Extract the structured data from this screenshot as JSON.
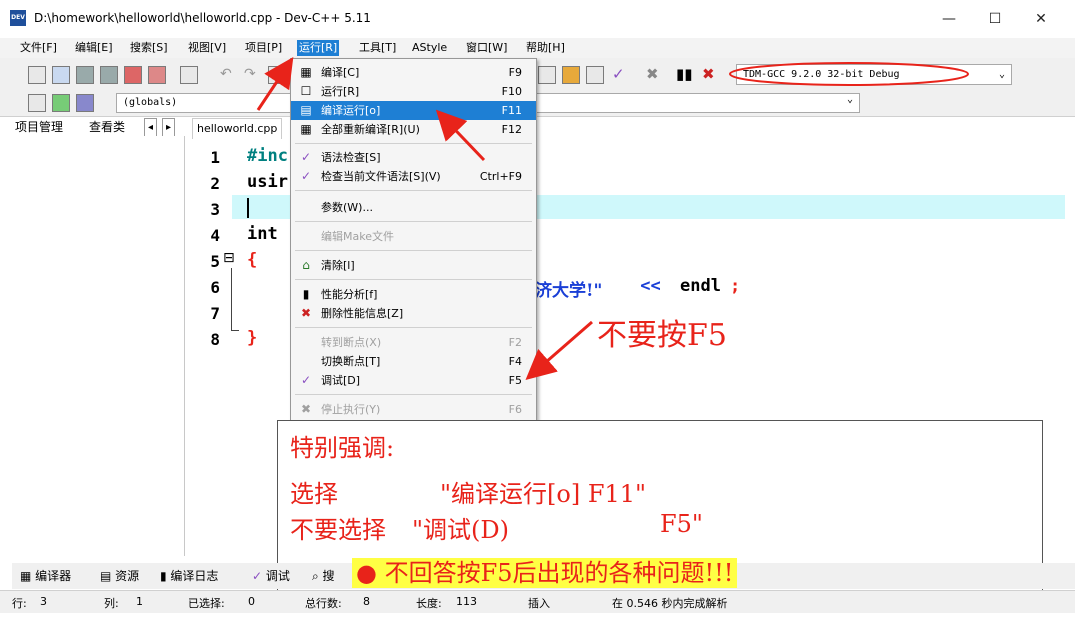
{
  "window": {
    "title": "D:\\homework\\helloworld\\helloworld.cpp - Dev-C++ 5.11",
    "app_icon_text": "DEV C++",
    "minimize": "—",
    "maximize": "☐",
    "close": "✕"
  },
  "menubar": {
    "items": [
      "文件[F]",
      "编辑[E]",
      "搜索[S]",
      "视图[V]",
      "项目[P]",
      "运行[R]",
      "工具[T]",
      "AStyle",
      "窗口[W]",
      "帮助[H]"
    ]
  },
  "toolbar": {
    "compiler_select": "TDM-GCC 9.2.0 32-bit Debug",
    "globals_select": "(globals)"
  },
  "left_tabs": {
    "project": "项目管理",
    "classes": "查看类",
    "prev": "◂",
    "next": "▸"
  },
  "editor": {
    "file_tab": "helloworld.cpp",
    "line_numbers": [
      "1",
      "2",
      "3",
      "4",
      "5",
      "6",
      "7",
      "8"
    ],
    "fold_marker": "⊟",
    "lines": {
      "l1": "#inc",
      "l2": "usir",
      "l4": "int",
      "l5": "{",
      "l6_str": "济大学!\"",
      "l6_op": " << ",
      "l6_rest": "endl",
      "l6_semi": ";",
      "l8": "}"
    }
  },
  "run_menu": {
    "items": [
      {
        "label": "编译[C]",
        "key": "F9",
        "icon": "▦"
      },
      {
        "label": "运行[R]",
        "key": "F10",
        "icon": "☐"
      },
      {
        "label": "编译运行[o]",
        "key": "F11",
        "icon": "▤"
      },
      {
        "label": "全部重新编译[R](U)",
        "key": "F12",
        "icon": "▦"
      },
      {
        "label": "语法检查[S]",
        "key": "",
        "icon": "✓"
      },
      {
        "label": "检查当前文件语法[S](V)",
        "key": "Ctrl+F9",
        "icon": "✓"
      },
      {
        "label": "参数(W)...",
        "key": "",
        "icon": ""
      },
      {
        "label": "编辑Make文件",
        "key": "",
        "icon": ""
      },
      {
        "label": "清除[l]",
        "key": "",
        "icon": "⌂"
      },
      {
        "label": "性能分析[f]",
        "key": "",
        "icon": "▮"
      },
      {
        "label": "删除性能信息[Z]",
        "key": "",
        "icon": "✖"
      },
      {
        "label": "转到断点(X)",
        "key": "F2",
        "icon": ""
      },
      {
        "label": "切换断点[T]",
        "key": "F4",
        "icon": ""
      },
      {
        "label": "调试[D]",
        "key": "F5",
        "icon": "✓"
      },
      {
        "label": "停止执行(Y)",
        "key": "F6",
        "icon": "✖"
      }
    ]
  },
  "annotations": {
    "no_f5": "不要按F5",
    "note_title": "特别强调:",
    "note_choose_a": "选择",
    "note_choose_b": "\"编译运行[o] F11\"",
    "note_dont_a": "不要选择",
    "note_dont_b": "\"调试(D)",
    "note_dont_c": "F5\"",
    "note_final": "● 不回答按F5后出现的各种问题!!!",
    "arrow_color": "#e8231a"
  },
  "bottom_tabs": {
    "compiler": "编译器",
    "resources": "资源",
    "compile_log": "编译日志",
    "debug": "调试",
    "search": "搜"
  },
  "statusbar": {
    "row_label": "行:",
    "row": "3",
    "col_label": "列:",
    "col": "1",
    "selected_label": "已选择:",
    "selected": "0",
    "total_label": "总行数:",
    "total": "8",
    "length_label": "长度:",
    "length": "113",
    "mode": "插入",
    "parse": "在 0.546 秒内完成解析"
  }
}
